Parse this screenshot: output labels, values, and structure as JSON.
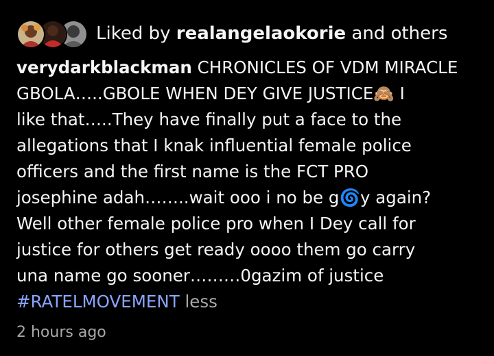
{
  "likes": {
    "prefix": "Liked by",
    "user": "realangelaokorie",
    "suffix": "and others"
  },
  "post": {
    "username": "verydarkblackman",
    "caption_lines": [
      "CHRONICLES OF VDM MIRACLE",
      "GBOLA…..GBOLE WHEN DEY GIVE JUSTICE🙈 I",
      "like that…..They have finally put a face to the",
      "allegations that I knak influential female police",
      "officers and the first name is the FCT PRO",
      "josephine adah……..wait ooo i no be g🌀y again?",
      "Well other female police pro when I Dey call for",
      "justice for others get ready oooo them go carry",
      "una name go sooner………0gazim of justice"
    ],
    "hashtag": "#RATELMOVEMENT",
    "less_label": "less",
    "timestamp": "2 hours ago"
  },
  "colors": {
    "background": "#000000",
    "text": "#f5f5f5",
    "hashtag": "#8aa5ff",
    "muted": "#a8a8a8"
  }
}
